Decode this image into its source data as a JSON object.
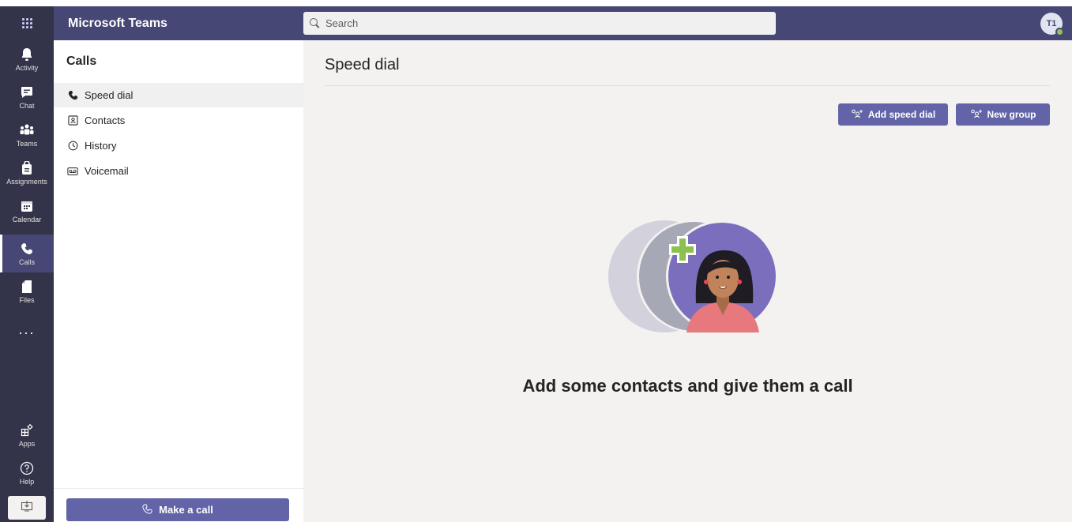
{
  "app": {
    "title": "Microsoft Teams"
  },
  "search": {
    "placeholder": "Search"
  },
  "user": {
    "initials": "T1",
    "status_color": "#92c353"
  },
  "rail": {
    "items": [
      {
        "label": "Activity",
        "icon": "bell-icon"
      },
      {
        "label": "Chat",
        "icon": "chat-icon"
      },
      {
        "label": "Teams",
        "icon": "teams-icon"
      },
      {
        "label": "Assignments",
        "icon": "assignments-icon"
      },
      {
        "label": "Calendar",
        "icon": "calendar-icon"
      },
      {
        "label": "Calls",
        "icon": "phone-icon",
        "active": true
      },
      {
        "label": "Files",
        "icon": "file-icon"
      }
    ],
    "more": "...",
    "bottom": [
      {
        "label": "Apps",
        "icon": "apps-icon"
      },
      {
        "label": "Help",
        "icon": "help-icon"
      }
    ]
  },
  "calls_panel": {
    "title": "Calls",
    "items": [
      {
        "label": "Speed dial",
        "icon": "phone-icon",
        "active": true
      },
      {
        "label": "Contacts",
        "icon": "contacts-icon"
      },
      {
        "label": "History",
        "icon": "clock-icon"
      },
      {
        "label": "Voicemail",
        "icon": "voicemail-icon"
      }
    ],
    "make_call": "Make a call"
  },
  "main": {
    "title": "Speed dial",
    "add_speed_dial": "Add speed dial",
    "new_group": "New group",
    "empty_message": "Add some contacts and give them a call"
  },
  "colors": {
    "header": "#464775",
    "rail": "#33344a",
    "accent": "#6264a7",
    "background": "#f3f2f1"
  }
}
